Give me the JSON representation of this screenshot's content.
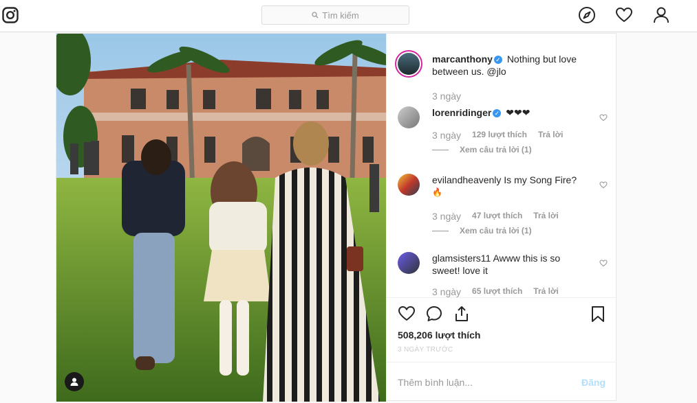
{
  "header": {
    "search_placeholder": "Tìm kiếm",
    "brand_color": "#262626"
  },
  "post": {
    "caption": {
      "username": "marcanthony",
      "text": "Nothing but love between us. @jlo",
      "time": "3 ngày"
    },
    "comments": [
      {
        "username": "lorenridinger",
        "verified": true,
        "text": "❤❤❤",
        "time": "3 ngày",
        "likes": "129 lượt thích",
        "reply": "Trả lời",
        "view_replies": "Xem câu trả lời (1)"
      },
      {
        "username": "evilandheavenly",
        "verified": false,
        "text": "Is my Song Fire?",
        "extra": "🔥",
        "time": "3 ngày",
        "likes": "47 lượt thích",
        "reply": "Trả lời",
        "view_replies": "Xem câu trả lời (1)"
      },
      {
        "username": "glamsisters11",
        "verified": false,
        "text": "Awww this is so sweet! love it",
        "time": "3 ngày",
        "likes": "65 lượt thích",
        "reply": "Trả lời"
      }
    ],
    "like_count": "508,206 lượt thích",
    "posted_time": "3 NGÀY TRƯỚC",
    "comment_placeholder": "Thêm bình luận...",
    "post_button": "Đăng",
    "accent_color": "#3897f0"
  }
}
